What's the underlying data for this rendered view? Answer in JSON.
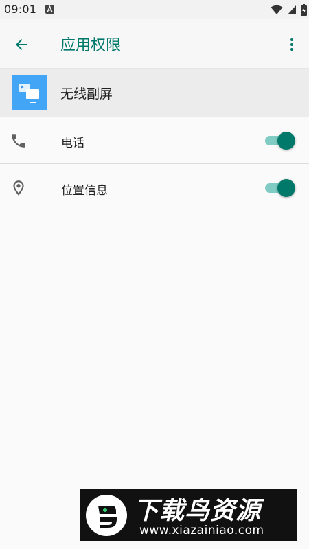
{
  "status_bar": {
    "time": "09:01",
    "notification_icon": "a-letter-icon",
    "wifi_icon": "wifi-icon",
    "signal_icon": "signal-icon",
    "battery_icon": "battery-charging-icon"
  },
  "app_bar": {
    "back_icon": "arrow-back-icon",
    "title": "应用权限",
    "more_icon": "more-vert-icon"
  },
  "app": {
    "icon": "wireless-display-app-icon",
    "name": "无线副屏"
  },
  "permissions": [
    {
      "icon": "phone-icon",
      "label": "电话",
      "enabled": true
    },
    {
      "icon": "location-pin-icon",
      "label": "位置信息",
      "enabled": true
    }
  ],
  "watermark": {
    "title": "下载鸟资源",
    "url": "www.xiazainiao.com"
  },
  "colors": {
    "accent": "#00796b",
    "toggle_track": "#80cbc4",
    "app_icon_bg": "#42a5f5",
    "background": "#fafafa"
  }
}
